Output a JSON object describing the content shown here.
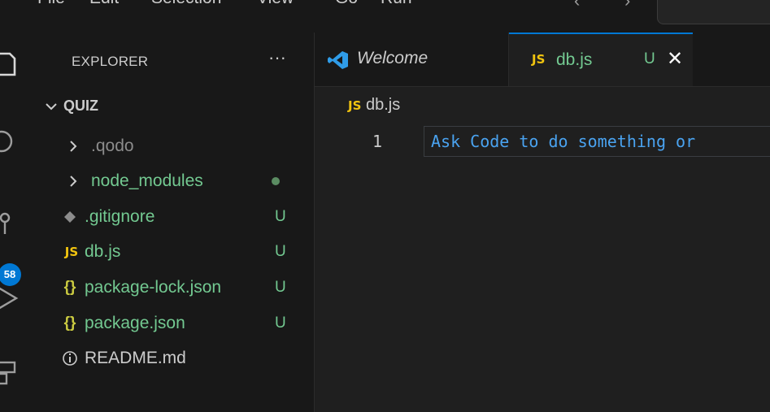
{
  "menubar": {
    "items": [
      "File",
      "Edit",
      "Selection",
      "View",
      "Go",
      "Run"
    ],
    "back_icon": "arrow-left-icon",
    "forward_icon": "arrow-right-icon"
  },
  "activity_bar": {
    "icons": [
      "files-icon",
      "search-icon",
      "source-control-icon",
      "run-debug-icon",
      "extensions-icon"
    ],
    "scm_badge": "58"
  },
  "explorer": {
    "title": "EXPLORER",
    "more_label": "···",
    "section": "QUIZ",
    "items": [
      {
        "name": ".qodo",
        "type": "folder",
        "status": ""
      },
      {
        "name": "node_modules",
        "type": "folder",
        "status": "●"
      },
      {
        "name": ".gitignore",
        "type": "gitignore",
        "status": "U"
      },
      {
        "name": "db.js",
        "type": "js",
        "status": "U"
      },
      {
        "name": "package-lock.json",
        "type": "json",
        "status": "U"
      },
      {
        "name": "package.json",
        "type": "json",
        "status": "U"
      },
      {
        "name": "README.md",
        "type": "info",
        "status": ""
      }
    ]
  },
  "tabs": [
    {
      "label": "Welcome",
      "icon": "vscode-logo-icon",
      "active": false
    },
    {
      "label": "db.js",
      "icon": "js-icon",
      "icon_text": "JS",
      "status": "U",
      "close": "✕",
      "active": true
    }
  ],
  "editor": {
    "breadcrumb_icon": "JS",
    "breadcrumb": "db.js",
    "line_number": "1",
    "ghost_text": "Ask Code to do something or"
  },
  "colors": {
    "accent": "#0078d4",
    "untracked": "#73c991",
    "js_icon": "#f1c40f",
    "json_icon": "#cbcb41",
    "ghost_text": "#4aa3f0"
  }
}
